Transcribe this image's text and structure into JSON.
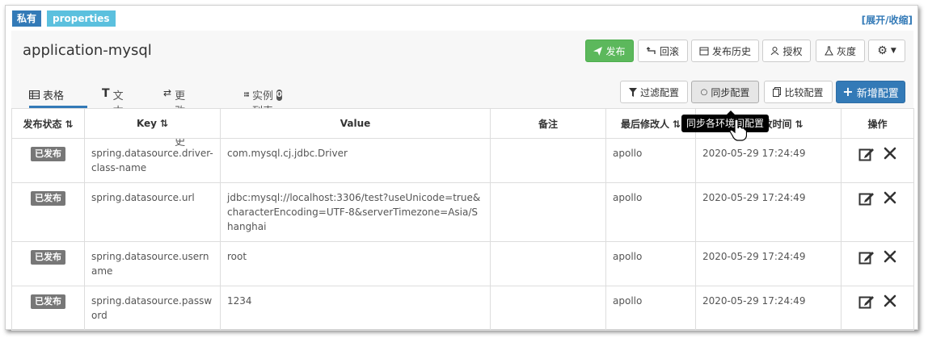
{
  "badges": {
    "scope": "私有",
    "format": "properties"
  },
  "toggle": "[展开/收缩]",
  "namespace": {
    "title": "application-mysql"
  },
  "actions": {
    "publish": "发布",
    "rollback": "回滚",
    "history": "发布历史",
    "grant": "授权",
    "gray": "灰度"
  },
  "tabs": [
    {
      "label": "表格",
      "icon": "table-icon"
    },
    {
      "label": "文本",
      "icon": "text-icon"
    },
    {
      "label": "更改历史",
      "icon": "history-icon"
    },
    {
      "label": "实例列表",
      "icon": "instances-icon",
      "count": "0"
    }
  ],
  "toolbar": {
    "filter": "过滤配置",
    "sync": "同步配置",
    "diff": "比较配置",
    "add": "新增配置"
  },
  "tooltip": "同步各环境间配置",
  "table": {
    "headers": [
      "发布状态",
      "Key",
      "Value",
      "备注",
      "最后修改人",
      "最后修改时间",
      "操作"
    ],
    "rows": [
      {
        "status": "已发布",
        "key": "spring.datasource.driver-class-name",
        "value": "com.mysql.cj.jdbc.Driver",
        "comment": "",
        "modifier": "apollo",
        "time": "2020-05-29 17:24:49"
      },
      {
        "status": "已发布",
        "key": "spring.datasource.url",
        "value": "jdbc:mysql://localhost:3306/test?useUnicode=true&characterEncoding=UTF-8&serverTimezone=Asia/Shanghai",
        "comment": "",
        "modifier": "apollo",
        "time": "2020-05-29 17:24:49"
      },
      {
        "status": "已发布",
        "key": "spring.datasource.username",
        "value": "root",
        "comment": "",
        "modifier": "apollo",
        "time": "2020-05-29 17:24:49"
      },
      {
        "status": "已发布",
        "key": "spring.datasource.password",
        "value": "1234",
        "comment": "",
        "modifier": "apollo",
        "time": "2020-05-29 17:24:49"
      }
    ]
  },
  "colors": {
    "primary": "#337ab7",
    "success": "#5cb85c",
    "info": "#5bc0de",
    "published": "#777777"
  }
}
